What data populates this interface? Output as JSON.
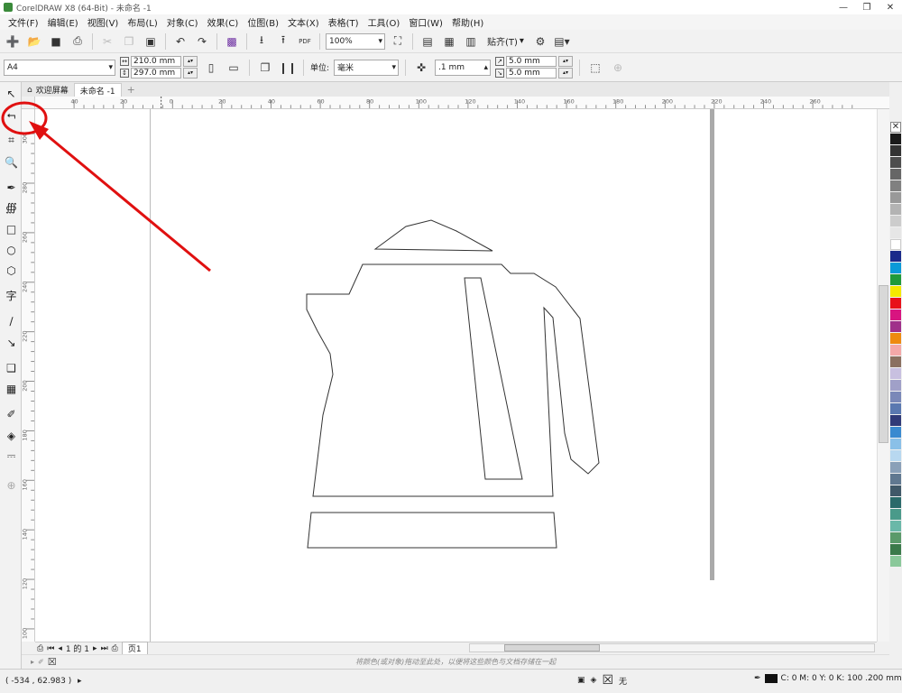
{
  "titlebar": {
    "title": "CorelDRAW X8 (64-Bit) - 未命名 -1",
    "minimize": "—",
    "restore": "❐",
    "close": "✕"
  },
  "menu": [
    "文件(F)",
    "编辑(E)",
    "视图(V)",
    "布局(L)",
    "对象(C)",
    "效果(C)",
    "位图(B)",
    "文本(X)",
    "表格(T)",
    "工具(O)",
    "窗口(W)",
    "帮助(H)"
  ],
  "toolbar1": {
    "zoom_value": "100%",
    "pdf_label": "PDF",
    "snap_label": "贴齐(T)"
  },
  "toolbar2": {
    "page_size": "A4",
    "width_value": "210.0 mm",
    "height_value": "297.0 mm",
    "unit_label": "单位:",
    "unit_value": "毫米",
    "nudge_value": ".1 mm",
    "dup_x": "5.0 mm",
    "dup_y": "5.0 mm"
  },
  "doc_tabs": {
    "welcome": "欢迎屏幕",
    "doc": "未命名 -1",
    "add": "+"
  },
  "ruler_h_labels": [
    "40",
    "20",
    "0",
    "20",
    "40",
    "60",
    "80",
    "100",
    "120",
    "140",
    "160",
    "180",
    "200",
    "220",
    "240",
    "260"
  ],
  "ruler_v_labels": [
    "300",
    "280",
    "260",
    "240",
    "220",
    "200",
    "180",
    "160",
    "140",
    "120",
    "100",
    "80"
  ],
  "pagebar": {
    "page_of": "1 的 1",
    "page_tab": "页1"
  },
  "hint": "将颜色(或对象)拖动至此处，以便将这些颜色与文档存储在一起",
  "status": {
    "coords": "( -534 , 62.983 )",
    "fill_none": "无",
    "fill_info": "C: 0 M: 0 Y: 0 K: 100  .200 mm"
  },
  "colors": {
    "annotation": "#e01010",
    "palette": [
      "#1a1a1a",
      "#333333",
      "#4d4d4d",
      "#666666",
      "#808080",
      "#999999",
      "#b3b3b3",
      "#cccccc",
      "#e6e6e6",
      "#ffffff",
      "#1a2a8a",
      "#0a9ad8",
      "#1f9a3a",
      "#f5e800",
      "#e8101a",
      "#d81480",
      "#a0308a",
      "#ee8a10",
      "#f4a8a8",
      "#8a7060",
      "#c8c0e0",
      "#a0a0c8",
      "#7a88b8",
      "#5a78b0",
      "#303a78",
      "#3a8ad0",
      "#8ac0e8",
      "#b8d8f0",
      "#8aa0b8",
      "#607890",
      "#405868",
      "#2a6a6a",
      "#4a9a8a",
      "#6ab8a8",
      "#5a9a6a",
      "#3a7a4a",
      "#8ac89a"
    ]
  }
}
